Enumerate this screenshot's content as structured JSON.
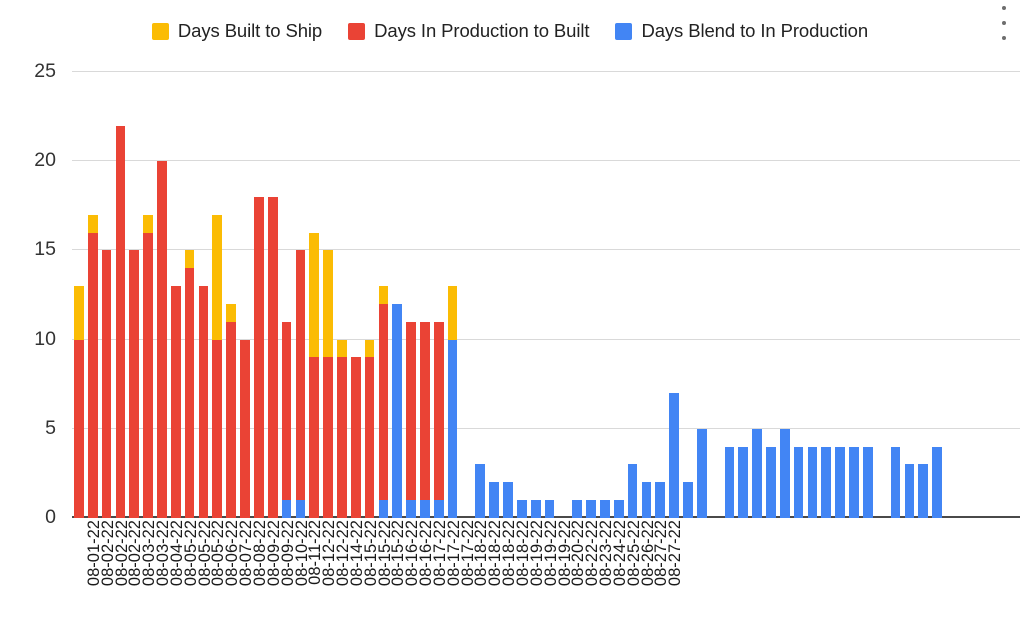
{
  "menu": {
    "name": "more-options",
    "label": "More options"
  },
  "colors": {
    "built_to_ship": "#FBBC04",
    "in_production_to_built": "#EA4335",
    "blend_to_in_production": "#4285F4",
    "gridline": "#D9D9D9",
    "axis": "#4A4A4A",
    "text": "#222222",
    "background": "#FFFFFF"
  },
  "legend": {
    "position": "top-center",
    "items": [
      {
        "label": "Days Built to Ship",
        "color": "#FBBC04"
      },
      {
        "label": "Days In Production to Built",
        "color": "#EA4335"
      },
      {
        "label": "Days Blend to In Production",
        "color": "#4285F4"
      }
    ]
  },
  "chart_data": {
    "type": "bar",
    "stacked": true,
    "title": "",
    "subtitle": "",
    "xlabel": "",
    "ylabel": "",
    "ylim": [
      0,
      25
    ],
    "yticks": [
      0,
      5,
      10,
      15,
      20,
      25
    ],
    "ytick_labels": [
      "0",
      "5",
      "10",
      "15",
      "20",
      "25"
    ],
    "grid": true,
    "grid_axis": "y",
    "legend_position": "top-center",
    "categories": [
      "08-01-22",
      "08-02-22",
      "08-02-22",
      "08-02-22",
      "08-03-22",
      "08-03-22",
      "08-04-22",
      "08-05-22",
      "08-05-22",
      "08-05-22",
      "08-06-22",
      "08-07-22",
      "08-08-22",
      "08-09-22",
      "08-09-22",
      "08-10-22",
      "08-11-22",
      "08-12-22",
      "08-12-22",
      "08-14-22",
      "08-15-22",
      "08-15-22",
      "08-15-22",
      "08-16-22",
      "08-16-22",
      "08-17-22",
      "08-17-22",
      "08-17-22",
      "08-18-22",
      "08-18-22",
      "08-18-22",
      "08-18-22",
      "08-19-22",
      "08-19-22",
      "08-19-22",
      "08-20-22",
      "08-22-22",
      "08-23-22",
      "08-24-22",
      "08-25-22",
      "08-26-22",
      "08-27-22",
      "08-27-22"
    ],
    "series": [
      {
        "name": "Days Blend to In Production",
        "color": "#4285F4",
        "values": [
          0,
          0,
          0,
          0,
          0,
          0,
          0,
          0,
          0,
          0,
          0,
          0,
          0,
          0,
          0,
          0,
          0,
          0,
          0,
          0,
          0,
          0,
          0,
          0,
          0,
          0,
          0,
          0,
          0,
          0,
          0,
          0,
          0,
          0,
          0,
          0,
          0,
          0,
          0,
          0,
          0,
          0,
          0
        ]
      },
      {
        "name": "Days In Production to Built",
        "color": "#EA4335",
        "values": [
          10,
          16,
          15,
          22,
          15,
          16,
          20,
          13,
          14,
          13,
          10,
          11,
          10,
          18,
          18,
          10,
          14,
          9,
          9,
          9,
          9,
          9,
          11,
          0,
          10,
          10,
          10,
          0,
          0,
          0,
          0,
          0,
          0,
          0,
          0,
          0,
          0,
          0,
          0,
          0,
          0,
          0,
          0
        ]
      },
      {
        "name": "Days Built to Ship",
        "color": "#FBBC04",
        "values": [
          3,
          1,
          0,
          0,
          0,
          1,
          0,
          0,
          1,
          0,
          7,
          1,
          0,
          0,
          0,
          0,
          1,
          7,
          6,
          1,
          0,
          1,
          2,
          0,
          0,
          0,
          0,
          3,
          0,
          0,
          0,
          0,
          0,
          0,
          0,
          0,
          0,
          0,
          0,
          0,
          0,
          0,
          0
        ]
      }
    ],
    "bars": [
      {
        "label": "08-01-22",
        "blend": 0,
        "production": 10,
        "ship": 3,
        "total": 13
      },
      {
        "label": "08-02-22",
        "blend": 0,
        "production": 16,
        "ship": 1,
        "total": 17
      },
      {
        "label": "08-02-22",
        "blend": 0,
        "production": 15,
        "ship": 0,
        "total": 15
      },
      {
        "label": "08-02-22",
        "blend": 0,
        "production": 22,
        "ship": 0,
        "total": 22
      },
      {
        "label": "08-03-22",
        "blend": 0,
        "production": 15,
        "ship": 0,
        "total": 15
      },
      {
        "label": "08-03-22",
        "blend": 0,
        "production": 16,
        "ship": 1,
        "total": 17
      },
      {
        "label": "08-04-22",
        "blend": 0,
        "production": 20,
        "ship": 0,
        "total": 20
      },
      {
        "label": "08-05-22",
        "blend": 0,
        "production": 13,
        "ship": 0,
        "total": 13
      },
      {
        "label": "08-05-22",
        "blend": 0,
        "production": 14,
        "ship": 1,
        "total": 15
      },
      {
        "label": "08-05-22",
        "blend": 0,
        "production": 13,
        "ship": 0,
        "total": 13
      },
      {
        "label": "08-06-22",
        "blend": 0,
        "production": 10,
        "ship": 7,
        "total": 17
      },
      {
        "label": "08-07-22",
        "blend": 0,
        "production": 11,
        "ship": 1,
        "total": 12
      },
      {
        "label": "08-08-22",
        "blend": 0,
        "production": 10,
        "ship": 0,
        "total": 10
      },
      {
        "label": "08-09-22",
        "blend": 0,
        "production": 18,
        "ship": 0,
        "total": 18
      },
      {
        "label": "08-09-22",
        "blend": 0,
        "production": 18,
        "ship": 0,
        "total": 18
      },
      {
        "label": "08-10-22",
        "blend": 1,
        "production": 10,
        "ship": 0,
        "total": 11
      },
      {
        "label": "08-11-22",
        "blend": 1,
        "production": 14,
        "ship": 0,
        "total": 15
      },
      {
        "label": "08-12-22",
        "blend": 0,
        "production": 9,
        "ship": 7,
        "total": 16
      },
      {
        "label": "08-12-22",
        "blend": 0,
        "production": 9,
        "ship": 6,
        "total": 15
      },
      {
        "label": "08-14-22",
        "blend": 0,
        "production": 9,
        "ship": 1,
        "total": 10
      },
      {
        "label": "08-15-22",
        "blend": 0,
        "production": 9,
        "ship": 0,
        "total": 9
      },
      {
        "label": "08-15-22",
        "blend": 0,
        "production": 9,
        "ship": 1,
        "total": 10
      },
      {
        "label": "08-15-22",
        "blend": 1,
        "production": 11,
        "ship": 1,
        "total": 13
      },
      {
        "label": "08-16-22",
        "blend": 12,
        "production": 0,
        "ship": 0,
        "total": 12
      },
      {
        "label": "08-16-22",
        "blend": 1,
        "production": 10,
        "ship": 0,
        "total": 11
      },
      {
        "label": "08-17-22",
        "blend": 1,
        "production": 10,
        "ship": 0,
        "total": 11
      },
      {
        "label": "08-17-22",
        "blend": 1,
        "production": 10,
        "ship": 0,
        "total": 11
      },
      {
        "label": "08-17-22",
        "blend": 10,
        "production": 0,
        "ship": 3,
        "total": 13
      },
      {
        "label": "08-18-22",
        "blend": 3,
        "production": 0,
        "ship": 0,
        "total": 3
      },
      {
        "label": "08-18-22",
        "blend": 2,
        "production": 0,
        "ship": 0,
        "total": 2
      },
      {
        "label": "08-18-22",
        "blend": 2,
        "production": 0,
        "ship": 0,
        "total": 2
      },
      {
        "label": "08-18-22",
        "blend": 1,
        "production": 0,
        "ship": 0,
        "total": 1
      },
      {
        "label": "08-19-22",
        "blend": 1,
        "production": 0,
        "ship": 0,
        "total": 1
      },
      {
        "label": "08-19-22",
        "blend": 1,
        "production": 0,
        "ship": 0,
        "total": 1
      },
      {
        "label": "08-19-22",
        "blend": 0,
        "production": 0,
        "ship": 0,
        "total": 0
      },
      {
        "label": "08-20-22",
        "blend": 1,
        "production": 0,
        "ship": 0,
        "total": 1
      },
      {
        "label": "08-22-22",
        "blend": 1,
        "production": 0,
        "ship": 0,
        "total": 1
      },
      {
        "label": "08-23-22",
        "blend": 1,
        "production": 0,
        "ship": 0,
        "total": 1
      },
      {
        "label": "08-24-22",
        "blend": 1,
        "production": 0,
        "ship": 0,
        "total": 1
      },
      {
        "label": "08-25-22",
        "blend": 3,
        "production": 0,
        "ship": 0,
        "total": 3
      },
      {
        "label": "08-26-22",
        "blend": 2,
        "production": 0,
        "ship": 0,
        "total": 2
      },
      {
        "label": "08-27-22",
        "blend": 2,
        "production": 0,
        "ship": 0,
        "total": 2
      },
      {
        "label": "08-27-22",
        "blend": 7,
        "production": 0,
        "ship": 0,
        "total": 7
      }
    ],
    "extra_bars": [
      {
        "blend": 2,
        "production": 0,
        "ship": 0,
        "total": 2
      },
      {
        "blend": 5,
        "production": 0,
        "ship": 0,
        "total": 5
      },
      {
        "blend": 4,
        "production": 0,
        "ship": 0,
        "total": 4
      },
      {
        "blend": 4,
        "production": 0,
        "ship": 0,
        "total": 4
      },
      {
        "blend": 5,
        "production": 0,
        "ship": 0,
        "total": 5
      },
      {
        "blend": 4,
        "production": 0,
        "ship": 0,
        "total": 4
      },
      {
        "blend": 5,
        "production": 0,
        "ship": 0,
        "total": 5
      },
      {
        "blend": 4,
        "production": 0,
        "ship": 0,
        "total": 4
      },
      {
        "blend": 4,
        "production": 0,
        "ship": 0,
        "total": 4
      },
      {
        "blend": 4,
        "production": 0,
        "ship": 0,
        "total": 4
      },
      {
        "blend": 4,
        "production": 0,
        "ship": 0,
        "total": 4
      },
      {
        "blend": 4,
        "production": 0,
        "ship": 0,
        "total": 4
      },
      {
        "blend": 4,
        "production": 0,
        "ship": 0,
        "total": 4
      },
      {
        "blend": 3,
        "production": 0,
        "ship": 0,
        "total": 3
      },
      {
        "blend": 3,
        "production": 0,
        "ship": 0,
        "total": 3
      },
      {
        "blend": 4,
        "production": 0,
        "ship": 0,
        "total": 4
      }
    ]
  },
  "render": {
    "note": "bar_layout holds the full left-to-right rendering sequence actually drawn in the figure",
    "x_tick_count": 59,
    "bar_layout": [
      {
        "label": "08-01-22",
        "blend": 0,
        "production": 10,
        "ship": 3
      },
      {
        "label": "08-02-22",
        "blend": 0,
        "production": 16,
        "ship": 1
      },
      {
        "label": "08-02-22",
        "blend": 0,
        "production": 15,
        "ship": 0
      },
      {
        "label": "08-02-22",
        "blend": 0,
        "production": 22,
        "ship": 0
      },
      {
        "label": "08-03-22",
        "blend": 0,
        "production": 15,
        "ship": 0
      },
      {
        "label": "08-03-22",
        "blend": 0,
        "production": 16,
        "ship": 1
      },
      {
        "label": "08-04-22",
        "blend": 0,
        "production": 20,
        "ship": 0
      },
      {
        "label": "08-05-22",
        "blend": 0,
        "production": 13,
        "ship": 0
      },
      {
        "label": "08-05-22",
        "blend": 0,
        "production": 14,
        "ship": 1
      },
      {
        "label": "08-05-22",
        "blend": 0,
        "production": 13,
        "ship": 0
      },
      {
        "label": "08-06-22",
        "blend": 0,
        "production": 10,
        "ship": 7
      },
      {
        "label": "08-07-22",
        "blend": 0,
        "production": 11,
        "ship": 1
      },
      {
        "label": "08-08-22",
        "blend": 0,
        "production": 10,
        "ship": 0
      },
      {
        "label": "08-09-22",
        "blend": 0,
        "production": 18,
        "ship": 0
      },
      {
        "label": "08-09-22",
        "blend": 0,
        "production": 18,
        "ship": 0
      },
      {
        "label": "08-10-22",
        "blend": 1,
        "production": 10,
        "ship": 0
      },
      {
        "label": "08-11-22",
        "blend": 1,
        "production": 14,
        "ship": 0
      },
      {
        "label": "08-12-22",
        "blend": 0,
        "production": 9,
        "ship": 7
      },
      {
        "label": "08-12-22",
        "blend": 0,
        "production": 9,
        "ship": 6
      },
      {
        "label": "08-14-22",
        "blend": 0,
        "production": 9,
        "ship": 1
      },
      {
        "label": "08-15-22",
        "blend": 0,
        "production": 9,
        "ship": 0
      },
      {
        "label": "08-15-22",
        "blend": 0,
        "production": 9,
        "ship": 1
      },
      {
        "label": "08-15-22",
        "blend": 1,
        "production": 11,
        "ship": 1
      },
      {
        "label": "08-16-22",
        "blend": 12,
        "production": 0,
        "ship": 0
      },
      {
        "label": "08-16-22",
        "blend": 1,
        "production": 10,
        "ship": 0
      },
      {
        "label": "08-17-22",
        "blend": 1,
        "production": 10,
        "ship": 0
      },
      {
        "label": "08-17-22",
        "blend": 1,
        "production": 10,
        "ship": 0
      },
      {
        "label": "08-17-22",
        "blend": 10,
        "production": 0,
        "ship": 3
      },
      {
        "label": "08-18-22",
        "blend": 0,
        "production": 0,
        "ship": 0
      },
      {
        "label": "08-18-22",
        "blend": 3,
        "production": 0,
        "ship": 0
      },
      {
        "label": "08-18-22",
        "blend": 2,
        "production": 0,
        "ship": 0
      },
      {
        "label": "08-18-22",
        "blend": 2,
        "production": 0,
        "ship": 0
      },
      {
        "label": "08-19-22",
        "blend": 1,
        "production": 0,
        "ship": 0
      },
      {
        "label": "08-19-22",
        "blend": 1,
        "production": 0,
        "ship": 0
      },
      {
        "label": "08-19-22",
        "blend": 1,
        "production": 0,
        "ship": 0
      },
      {
        "label": "08-20-22",
        "blend": 0,
        "production": 0,
        "ship": 0
      },
      {
        "label": "08-22-22",
        "blend": 1,
        "production": 0,
        "ship": 0
      },
      {
        "label": "08-23-22",
        "blend": 1,
        "production": 0,
        "ship": 0
      },
      {
        "label": "08-24-22",
        "blend": 1,
        "production": 0,
        "ship": 0
      },
      {
        "label": "08-25-22",
        "blend": 1,
        "production": 0,
        "ship": 0
      },
      {
        "label": "08-26-22",
        "blend": 3,
        "production": 0,
        "ship": 0
      },
      {
        "label": "08-27-22",
        "blend": 2,
        "production": 0,
        "ship": 0
      },
      {
        "label": "08-27-22",
        "blend": 2,
        "production": 0,
        "ship": 0
      },
      {
        "label": "",
        "blend": 7,
        "production": 0,
        "ship": 0
      },
      {
        "label": "",
        "blend": 2,
        "production": 0,
        "ship": 0
      },
      {
        "label": "",
        "blend": 5,
        "production": 0,
        "ship": 0
      },
      {
        "label": "",
        "blend": 0,
        "production": 0,
        "ship": 0
      },
      {
        "label": "",
        "blend": 4,
        "production": 0,
        "ship": 0
      },
      {
        "label": "",
        "blend": 4,
        "production": 0,
        "ship": 0
      },
      {
        "label": "",
        "blend": 5,
        "production": 0,
        "ship": 0
      },
      {
        "label": "",
        "blend": 4,
        "production": 0,
        "ship": 0
      },
      {
        "label": "",
        "blend": 5,
        "production": 0,
        "ship": 0
      },
      {
        "label": "",
        "blend": 4,
        "production": 0,
        "ship": 0
      },
      {
        "label": "",
        "blend": 4,
        "production": 0,
        "ship": 0
      },
      {
        "label": "",
        "blend": 4,
        "production": 0,
        "ship": 0
      },
      {
        "label": "",
        "blend": 4,
        "production": 0,
        "ship": 0
      },
      {
        "label": "",
        "blend": 4,
        "production": 0,
        "ship": 0
      },
      {
        "label": "",
        "blend": 4,
        "production": 0,
        "ship": 0
      },
      {
        "label": "",
        "blend": 0,
        "production": 0,
        "ship": 0
      },
      {
        "label": "",
        "blend": 4,
        "production": 0,
        "ship": 0
      },
      {
        "label": "",
        "blend": 3,
        "production": 0,
        "ship": 0
      },
      {
        "label": "",
        "blend": 3,
        "production": 0,
        "ship": 0
      },
      {
        "label": "",
        "blend": 4,
        "production": 0,
        "ship": 0
      },
      {
        "label": "",
        "blend": 0,
        "production": 0,
        "ship": 0
      },
      {
        "label": "",
        "blend": 0,
        "production": 0,
        "ship": 0
      },
      {
        "label": "",
        "blend": 0,
        "production": 0,
        "ship": 0
      },
      {
        "label": "",
        "blend": 0,
        "production": 0,
        "ship": 0
      },
      {
        "label": "",
        "blend": 0,
        "production": 0,
        "ship": 0
      },
      {
        "label": "",
        "blend": 0,
        "production": 0,
        "ship": 0
      }
    ],
    "x_tick_labels": [
      "08-01-22",
      "08-02-22",
      "08-02-22",
      "08-02-22",
      "08-03-22",
      "08-03-22",
      "08-04-22",
      "08-05-22",
      "08-05-22",
      "08-05-22",
      "08-06-22",
      "08-07-22",
      "08-08-22",
      "08-09-22",
      "08-09-22",
      "08-10-22",
      "08-11-22",
      "08-12-22",
      "08-12-22",
      "08-14-22",
      "08-15-22",
      "08-15-22",
      "08-15-22",
      "08-16-22",
      "08-16-22",
      "08-17-22",
      "08-17-22",
      "08-17-22",
      "08-18-22",
      "08-18-22",
      "08-18-22",
      "08-18-22",
      "08-19-22",
      "08-19-22",
      "08-19-22",
      "08-20-22",
      "08-22-22",
      "08-23-22",
      "08-24-22",
      "08-25-22",
      "08-26-22",
      "08-27-22",
      "08-27-22"
    ]
  }
}
